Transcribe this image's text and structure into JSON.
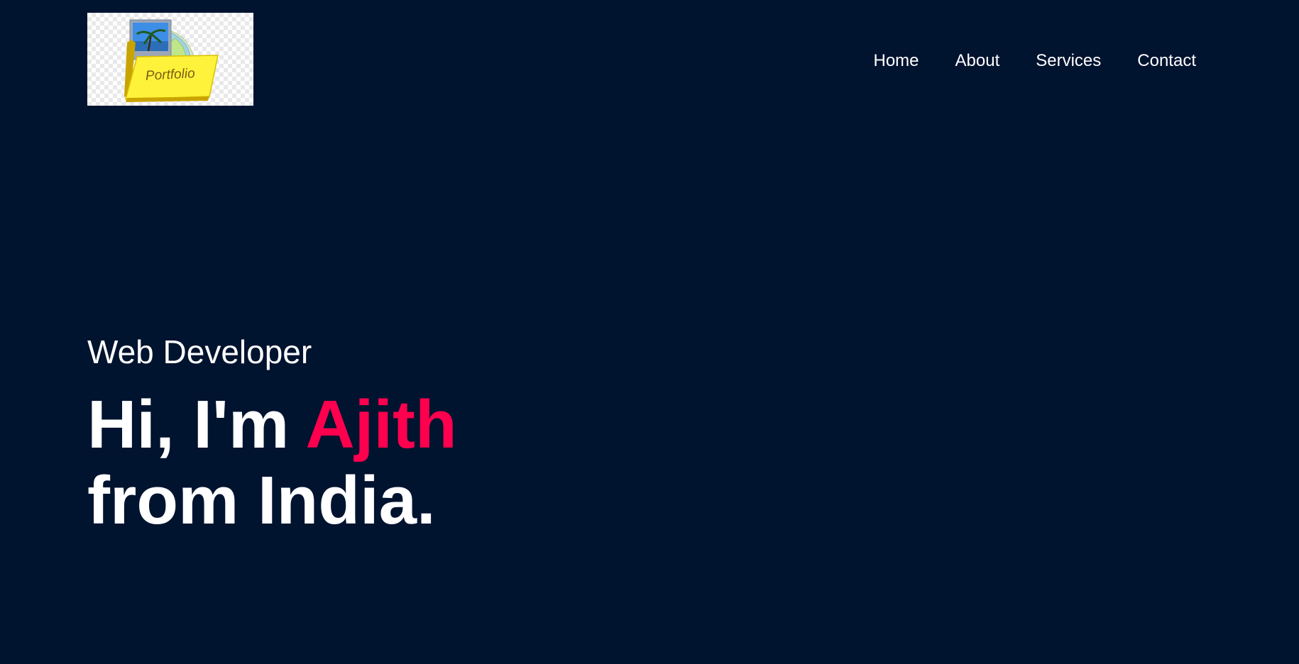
{
  "header": {
    "logo": {
      "text": "Portfolio",
      "icon": "folder-icon",
      "colors": {
        "folder": "#fff23a",
        "folder_shadow": "#c9a400"
      }
    },
    "nav": {
      "items": [
        {
          "label": "Home"
        },
        {
          "label": "About"
        },
        {
          "label": "Services"
        },
        {
          "label": "Contact"
        }
      ]
    }
  },
  "hero": {
    "subtitle": "Web Developer",
    "greeting": "Hi, I'm",
    "name": "Ajith",
    "line2": "from India."
  },
  "colors": {
    "background": "#00132f",
    "text": "#ffffff",
    "accent": "#ff004f"
  }
}
